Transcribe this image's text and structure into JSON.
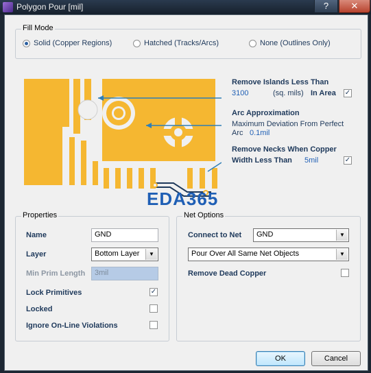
{
  "window": {
    "title": "Polygon Pour [mil]",
    "help": "?",
    "close": "✕"
  },
  "fill_mode": {
    "title": "Fill Mode",
    "options": [
      "Solid (Copper Regions)",
      "Hatched (Tracks/Arcs)",
      "None (Outlines Only)"
    ],
    "selected": "Solid (Copper Regions)"
  },
  "settings": {
    "remove_islands": {
      "label": "Remove Islands Less Than",
      "value": "3100",
      "unit": "(sq. mils)",
      "in_area": "In Area",
      "checked": true
    },
    "arc_approx": {
      "label": "Arc Approximation",
      "sub1": "Maximum Deviation From Perfect",
      "sub2": "Arc",
      "value": "0.1mil"
    },
    "remove_necks": {
      "label1": "Remove Necks When Copper",
      "label2": "Width Less Than",
      "value": "5mil",
      "checked": true
    }
  },
  "watermark": "EDA365",
  "properties": {
    "title": "Properties",
    "name_label": "Name",
    "name_value": "GND",
    "layer_label": "Layer",
    "layer_value": "Bottom Layer",
    "min_prim_label": "Min Prim Length",
    "min_prim_value": "3mil",
    "lock_primitives": {
      "label": "Lock Primitives",
      "checked": true
    },
    "locked": {
      "label": "Locked",
      "checked": false
    },
    "ignore_online": {
      "label": "Ignore On-Line Violations",
      "checked": false
    }
  },
  "net_options": {
    "title": "Net Options",
    "connect_label": "Connect to Net",
    "connect_value": "GND",
    "pour_value": "Pour Over All Same Net Objects",
    "remove_dead": {
      "label": "Remove Dead Copper",
      "checked": false
    }
  },
  "buttons": {
    "ok": "OK",
    "cancel": "Cancel"
  },
  "colors": {
    "copper": "#f5b731",
    "guide": "#2f7fb6",
    "accent": "#1f5fb5"
  }
}
